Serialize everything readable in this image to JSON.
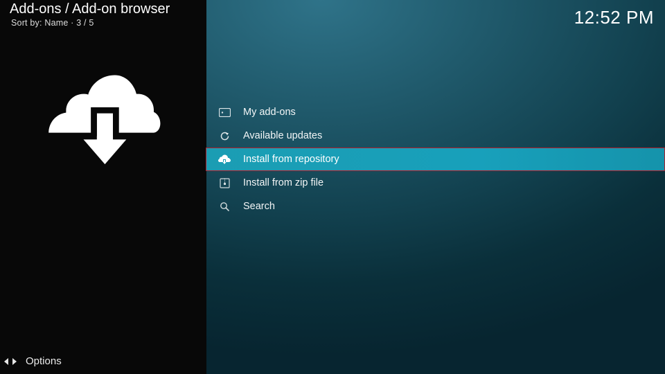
{
  "header": {
    "breadcrumb": "Add-ons / Add-on browser",
    "sort": "Sort by: Name  ·  3 / 5",
    "clock": "12:52 PM"
  },
  "footer": {
    "options_label": "Options"
  },
  "items": [
    {
      "icon": "box",
      "label": "My add-ons",
      "selected": false
    },
    {
      "icon": "refresh",
      "label": "Available updates",
      "selected": false
    },
    {
      "icon": "cloud-download",
      "label": "Install from repository",
      "selected": true
    },
    {
      "icon": "zip",
      "label": "Install from zip file",
      "selected": false
    },
    {
      "icon": "search",
      "label": "Search",
      "selected": false
    }
  ],
  "selected_index": 2
}
